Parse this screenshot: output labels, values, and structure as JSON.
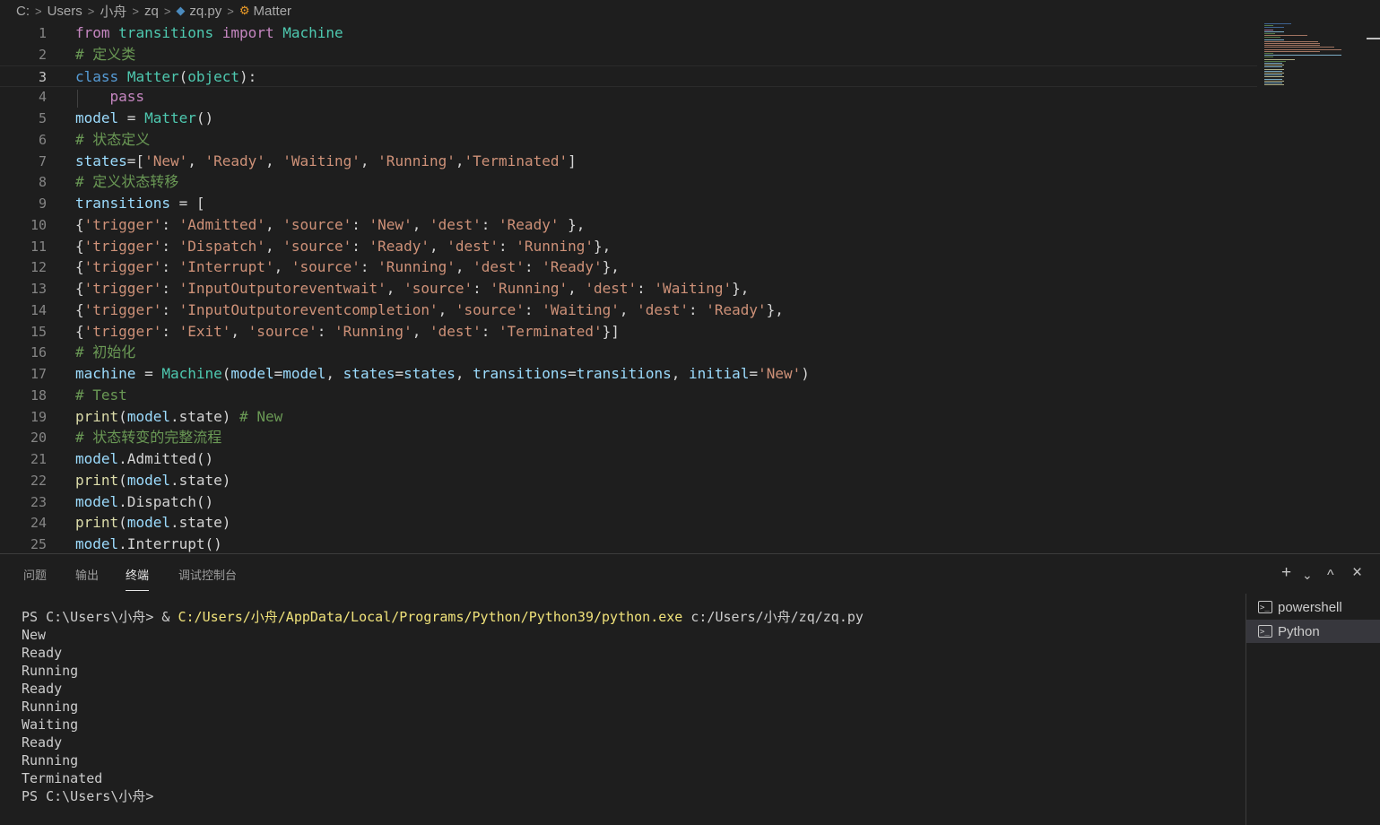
{
  "breadcrumb": {
    "items": [
      "C:",
      "Users",
      "小舟",
      "zq",
      "zq.py",
      "Matter"
    ],
    "file_icon": "python-file-icon",
    "symbol_icon": "class-symbol-icon"
  },
  "editor": {
    "current_line": 3,
    "lines": [
      {
        "n": "1",
        "tokens": [
          [
            "from",
            "t-ctl"
          ],
          [
            " ",
            ""
          ],
          [
            "transitions",
            "t-cls"
          ],
          [
            " ",
            ""
          ],
          [
            "import",
            "t-ctl"
          ],
          [
            " ",
            ""
          ],
          [
            "Machine",
            "t-cls"
          ]
        ]
      },
      {
        "n": "2",
        "tokens": [
          [
            "# 定义类",
            "t-com"
          ]
        ]
      },
      {
        "n": "3",
        "tokens": [
          [
            "class",
            "t-kw"
          ],
          [
            " ",
            ""
          ],
          [
            "Matter",
            "t-cls"
          ],
          [
            "(",
            ""
          ],
          [
            "object",
            "t-cls"
          ],
          [
            "):",
            ""
          ]
        ]
      },
      {
        "n": "4",
        "tokens": [
          [
            "    ",
            ""
          ],
          [
            "pass",
            "t-ctl"
          ]
        ]
      },
      {
        "n": "5",
        "tokens": [
          [
            "model",
            "t-var"
          ],
          [
            " = ",
            ""
          ],
          [
            "Matter",
            "t-cls"
          ],
          [
            "()",
            ""
          ]
        ]
      },
      {
        "n": "6",
        "tokens": [
          [
            "# 状态定义",
            "t-com"
          ]
        ]
      },
      {
        "n": "7",
        "tokens": [
          [
            "states",
            "t-var"
          ],
          [
            "=[",
            ""
          ],
          [
            "'New'",
            "t-str"
          ],
          [
            ", ",
            ""
          ],
          [
            "'Ready'",
            "t-str"
          ],
          [
            ", ",
            ""
          ],
          [
            "'Waiting'",
            "t-str"
          ],
          [
            ", ",
            ""
          ],
          [
            "'Running'",
            "t-str"
          ],
          [
            ",",
            ""
          ],
          [
            "'Terminated'",
            "t-str"
          ],
          [
            "]",
            ""
          ]
        ]
      },
      {
        "n": "8",
        "tokens": [
          [
            "# 定义状态转移",
            "t-com"
          ]
        ]
      },
      {
        "n": "9",
        "tokens": [
          [
            "transitions",
            "t-var"
          ],
          [
            " = [",
            ""
          ]
        ]
      },
      {
        "n": "10",
        "tokens": [
          [
            "{",
            ""
          ],
          [
            "'trigger'",
            "t-str"
          ],
          [
            ": ",
            ""
          ],
          [
            "'Admitted'",
            "t-str"
          ],
          [
            ", ",
            ""
          ],
          [
            "'source'",
            "t-str"
          ],
          [
            ": ",
            ""
          ],
          [
            "'New'",
            "t-str"
          ],
          [
            ", ",
            ""
          ],
          [
            "'dest'",
            "t-str"
          ],
          [
            ": ",
            ""
          ],
          [
            "'Ready'",
            "t-str"
          ],
          [
            " },",
            ""
          ]
        ]
      },
      {
        "n": "11",
        "tokens": [
          [
            "{",
            ""
          ],
          [
            "'trigger'",
            "t-str"
          ],
          [
            ": ",
            ""
          ],
          [
            "'Dispatch'",
            "t-str"
          ],
          [
            ", ",
            ""
          ],
          [
            "'source'",
            "t-str"
          ],
          [
            ": ",
            ""
          ],
          [
            "'Ready'",
            "t-str"
          ],
          [
            ", ",
            ""
          ],
          [
            "'dest'",
            "t-str"
          ],
          [
            ": ",
            ""
          ],
          [
            "'Running'",
            "t-str"
          ],
          [
            "},",
            ""
          ]
        ]
      },
      {
        "n": "12",
        "tokens": [
          [
            "{",
            ""
          ],
          [
            "'trigger'",
            "t-str"
          ],
          [
            ": ",
            ""
          ],
          [
            "'Interrupt'",
            "t-str"
          ],
          [
            ", ",
            ""
          ],
          [
            "'source'",
            "t-str"
          ],
          [
            ": ",
            ""
          ],
          [
            "'Running'",
            "t-str"
          ],
          [
            ", ",
            ""
          ],
          [
            "'dest'",
            "t-str"
          ],
          [
            ": ",
            ""
          ],
          [
            "'Ready'",
            "t-str"
          ],
          [
            "},",
            ""
          ]
        ]
      },
      {
        "n": "13",
        "tokens": [
          [
            "{",
            ""
          ],
          [
            "'trigger'",
            "t-str"
          ],
          [
            ": ",
            ""
          ],
          [
            "'InputOutputoreventwait'",
            "t-str"
          ],
          [
            ", ",
            ""
          ],
          [
            "'source'",
            "t-str"
          ],
          [
            ": ",
            ""
          ],
          [
            "'Running'",
            "t-str"
          ],
          [
            ", ",
            ""
          ],
          [
            "'dest'",
            "t-str"
          ],
          [
            ": ",
            ""
          ],
          [
            "'Waiting'",
            "t-str"
          ],
          [
            "},",
            ""
          ]
        ]
      },
      {
        "n": "14",
        "tokens": [
          [
            "{",
            ""
          ],
          [
            "'trigger'",
            "t-str"
          ],
          [
            ": ",
            ""
          ],
          [
            "'InputOutputoreventcompletion'",
            "t-str"
          ],
          [
            ", ",
            ""
          ],
          [
            "'source'",
            "t-str"
          ],
          [
            ": ",
            ""
          ],
          [
            "'Waiting'",
            "t-str"
          ],
          [
            ", ",
            ""
          ],
          [
            "'dest'",
            "t-str"
          ],
          [
            ": ",
            ""
          ],
          [
            "'Ready'",
            "t-str"
          ],
          [
            "},",
            ""
          ]
        ]
      },
      {
        "n": "15",
        "tokens": [
          [
            "{",
            ""
          ],
          [
            "'trigger'",
            "t-str"
          ],
          [
            ": ",
            ""
          ],
          [
            "'Exit'",
            "t-str"
          ],
          [
            ", ",
            ""
          ],
          [
            "'source'",
            "t-str"
          ],
          [
            ": ",
            ""
          ],
          [
            "'Running'",
            "t-str"
          ],
          [
            ", ",
            ""
          ],
          [
            "'dest'",
            "t-str"
          ],
          [
            ": ",
            ""
          ],
          [
            "'Terminated'",
            "t-str"
          ],
          [
            "}]",
            ""
          ]
        ]
      },
      {
        "n": "16",
        "tokens": [
          [
            "# 初始化",
            "t-com"
          ]
        ]
      },
      {
        "n": "17",
        "tokens": [
          [
            "machine",
            "t-var"
          ],
          [
            " = ",
            ""
          ],
          [
            "Machine",
            "t-cls"
          ],
          [
            "(",
            ""
          ],
          [
            "model",
            "t-var"
          ],
          [
            "=",
            ""
          ],
          [
            "model",
            "t-var"
          ],
          [
            ", ",
            ""
          ],
          [
            "states",
            "t-var"
          ],
          [
            "=",
            ""
          ],
          [
            "states",
            "t-var"
          ],
          [
            ", ",
            ""
          ],
          [
            "transitions",
            "t-var"
          ],
          [
            "=",
            ""
          ],
          [
            "transitions",
            "t-var"
          ],
          [
            ", ",
            ""
          ],
          [
            "initial",
            "t-var"
          ],
          [
            "=",
            ""
          ],
          [
            "'New'",
            "t-str"
          ],
          [
            ")",
            ""
          ]
        ]
      },
      {
        "n": "18",
        "tokens": [
          [
            "# Test",
            "t-com"
          ]
        ]
      },
      {
        "n": "19",
        "tokens": [
          [
            "print",
            "t-fn"
          ],
          [
            "(",
            ""
          ],
          [
            "model",
            "t-var"
          ],
          [
            ".state) ",
            ""
          ],
          [
            "# New",
            "t-com"
          ]
        ]
      },
      {
        "n": "20",
        "tokens": [
          [
            "# 状态转变的完整流程",
            "t-com"
          ]
        ]
      },
      {
        "n": "21",
        "tokens": [
          [
            "model",
            "t-var"
          ],
          [
            ".Admitted()",
            ""
          ]
        ]
      },
      {
        "n": "22",
        "tokens": [
          [
            "print",
            "t-fn"
          ],
          [
            "(",
            ""
          ],
          [
            "model",
            "t-var"
          ],
          [
            ".state)",
            ""
          ]
        ]
      },
      {
        "n": "23",
        "tokens": [
          [
            "model",
            "t-var"
          ],
          [
            ".Dispatch()",
            ""
          ]
        ]
      },
      {
        "n": "24",
        "tokens": [
          [
            "print",
            "t-fn"
          ],
          [
            "(",
            ""
          ],
          [
            "model",
            "t-var"
          ],
          [
            ".state)",
            ""
          ]
        ]
      },
      {
        "n": "25",
        "tokens": [
          [
            "model",
            "t-var"
          ],
          [
            ".Interrupt()",
            ""
          ]
        ]
      }
    ]
  },
  "panel": {
    "tabs": [
      {
        "label": "问题",
        "active": false
      },
      {
        "label": "输出",
        "active": false
      },
      {
        "label": "终端",
        "active": true
      },
      {
        "label": "调试控制台",
        "active": false
      }
    ],
    "actions": {
      "add": "+",
      "split": "⌄",
      "maximize": "^",
      "close": "×"
    }
  },
  "terminal": {
    "command_prompt": "PS C:\\Users\\小舟> & ",
    "command_exe": "C:/Users/小舟/AppData/Local/Programs/Python/Python39/python.exe",
    "command_arg": " c:/Users/小舟/zq/zq.py",
    "output": [
      "New",
      "Ready",
      "Running",
      "Ready",
      "Running",
      "Waiting",
      "Ready",
      "Running",
      "Terminated"
    ],
    "final_prompt": "PS C:\\Users\\小舟>"
  },
  "terminal_list": [
    {
      "label": "powershell",
      "selected": false,
      "icon": "terminal-icon"
    },
    {
      "label": "Python",
      "selected": true,
      "icon": "terminal-icon"
    }
  ]
}
